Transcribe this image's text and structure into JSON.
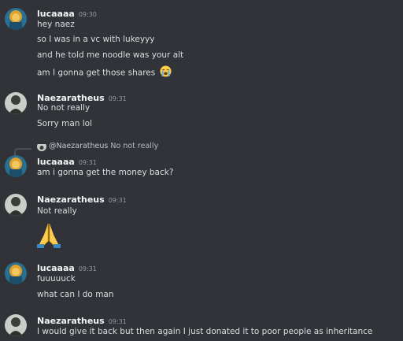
{
  "messages": [
    {
      "author": "lucaaaa",
      "time": "09:30",
      "lines": [
        "hey naez",
        "so I was in a vc with lukeyyy",
        "and he told me noodle was your alt",
        "am I gonna get those shares"
      ],
      "trailing_emoji": "loudly-crying-face"
    },
    {
      "author": "Naezaratheus",
      "time": "09:31",
      "lines": [
        "No not really",
        "Sorry man lol"
      ]
    },
    {
      "reply": {
        "user": "@Naezaratheus",
        "text": "No not really"
      },
      "author": "lucaaaa",
      "time": "09:31",
      "lines": [
        "am i gonna get the money back?"
      ]
    },
    {
      "author": "Naezaratheus",
      "time": "09:31",
      "lines": [
        "Not really"
      ],
      "big_emoji": "folded-hands"
    },
    {
      "author": "lucaaaa",
      "time": "09:31",
      "lines": [
        "fuuuuuck",
        "what can I do man"
      ]
    },
    {
      "author": "Naezaratheus",
      "time": "09:31",
      "lines": [
        "I would give it back but then again I just donated it to poor people as inheritance"
      ]
    }
  ],
  "colors": {
    "background": "#313338",
    "username": "#f2f3f5",
    "text": "#dbdee1",
    "timestamp": "#949ba4"
  }
}
